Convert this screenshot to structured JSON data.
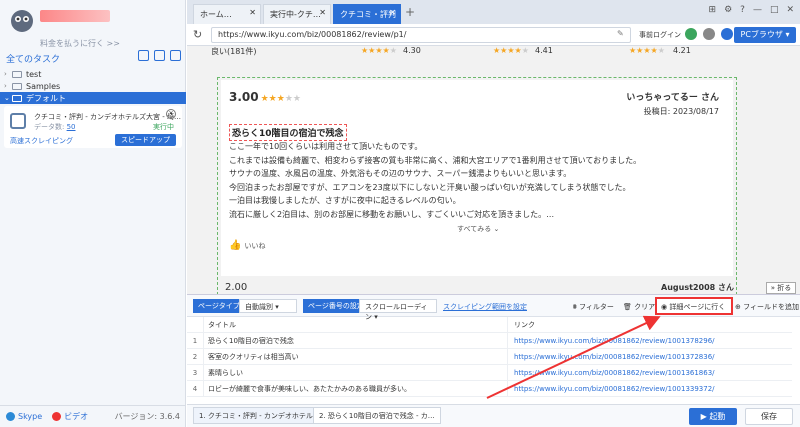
{
  "sidebar": {
    "pay_link": "料金を払うに行く >>",
    "all_tasks": "全てのタスク",
    "folders": [
      {
        "label": "test"
      },
      {
        "label": "Samples"
      },
      {
        "label": "デフォルト"
      }
    ],
    "task": {
      "name": "クチコミ・評判 - カンデオホテルズ大宮 - 埼…",
      "meta_label": "データ数:",
      "meta_value": "50",
      "status": "実行中",
      "mode": "高速スクレイピング",
      "speed_button": "スピードアップ"
    },
    "skype": "Skype",
    "video": "ビデオ",
    "version": "バージョン: 3.6.4"
  },
  "browser": {
    "tabs": [
      "ホーム…",
      "実行中-クチ…",
      "クチコミ・評判"
    ],
    "url": "https://www.ikyu.com/biz/00081862/review/p1/",
    "login": "事前ログイン",
    "pc_browser": "PCブラウザ"
  },
  "page": {
    "prev_label": "良い(181件)",
    "prev_scores": [
      "4.30",
      "4.41",
      "4.21"
    ],
    "review": {
      "score": "3.00",
      "author": "いっちゃってるー さん",
      "date": "投稿日: 2023/08/17",
      "title": "恐らく10階目の宿泊で残念",
      "lines": [
        "ここ一年で10回くらいは利用させて頂いたものです。",
        "これまでは設備も綺麗で、相変わらず接客の質も非常に高く、浦和大宮エリアで1番利用させて頂いておりました。",
        "サウナの温度、水風呂の温度、外気浴もその辺のサウナ、スーパー銭湯よりもいいと思います。",
        "今回泊まったお部屋ですが、エアコンを23度以下にしないと汗臭い酸っぱい匂いが充満してしまう状態でした。",
        "一泊目は我慢しましたが、さすがに夜中に起きるレベルの匂い。",
        "流石に厳しく2泊目は、別のお部屋に移動をお願いし、すごくいいご対応を頂きました。…"
      ],
      "see_all": "すべてみる",
      "like": "いいね"
    },
    "next_score": "2.00",
    "next_author": "August2008 さん",
    "fold": "折る"
  },
  "toolbar": {
    "page_type": "ページタイプ",
    "auto_detect": "自動識別",
    "page_number": "ページ番号の設定",
    "scroll_loading": "スクロールローディン",
    "scrape_range": "スクレイピング範囲を設定",
    "filter": "フィルター",
    "clear": "クリア",
    "goto_detail": "詳細ページに行く",
    "add_field": "フィールドを追加"
  },
  "table": {
    "headers": [
      "タイトル",
      "リンク"
    ],
    "rows": [
      {
        "n": "1",
        "title": "恐らく10階目の宿泊で残念",
        "link": "https://www.ikyu.com/biz/00081862/review/1001378296/"
      },
      {
        "n": "2",
        "title": "客室のクオリティは相当高い",
        "link": "https://www.ikyu.com/biz/00081862/review/1001372836/"
      },
      {
        "n": "3",
        "title": "素晴らしい",
        "link": "https://www.ikyu.com/biz/00081862/review/1001361863/"
      },
      {
        "n": "4",
        "title": "ロビーが綺麗で食事が美味しい、あたたかみのある職員が多い。",
        "link": "https://www.ikyu.com/biz/00081862/review/1001339372/"
      }
    ]
  },
  "footer": {
    "tabs": [
      "1. クチコミ・評判 - カンデオホテル…",
      "2. 恐らく10階目の宿泊で残念 - カ…"
    ],
    "launch": "起動",
    "save": "保存"
  },
  "colors": {
    "accent": "#2b6fd6",
    "star": "#f5a623",
    "highlight": "#e33333"
  }
}
